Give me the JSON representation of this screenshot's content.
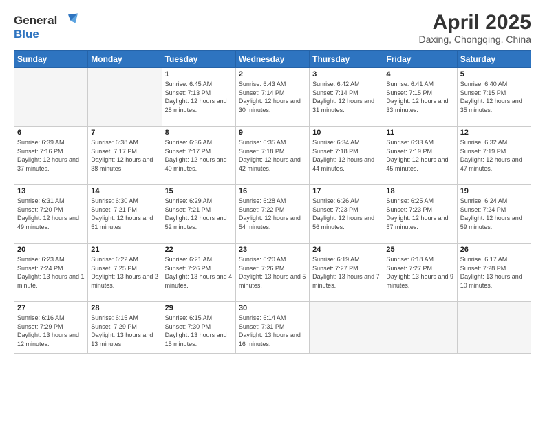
{
  "header": {
    "logo_line1": "General",
    "logo_line2": "Blue",
    "month_title": "April 2025",
    "subtitle": "Daxing, Chongqing, China"
  },
  "weekdays": [
    "Sunday",
    "Monday",
    "Tuesday",
    "Wednesday",
    "Thursday",
    "Friday",
    "Saturday"
  ],
  "weeks": [
    [
      {
        "day": "",
        "info": ""
      },
      {
        "day": "",
        "info": ""
      },
      {
        "day": "1",
        "info": "Sunrise: 6:45 AM\nSunset: 7:13 PM\nDaylight: 12 hours and 28 minutes."
      },
      {
        "day": "2",
        "info": "Sunrise: 6:43 AM\nSunset: 7:14 PM\nDaylight: 12 hours and 30 minutes."
      },
      {
        "day": "3",
        "info": "Sunrise: 6:42 AM\nSunset: 7:14 PM\nDaylight: 12 hours and 31 minutes."
      },
      {
        "day": "4",
        "info": "Sunrise: 6:41 AM\nSunset: 7:15 PM\nDaylight: 12 hours and 33 minutes."
      },
      {
        "day": "5",
        "info": "Sunrise: 6:40 AM\nSunset: 7:15 PM\nDaylight: 12 hours and 35 minutes."
      }
    ],
    [
      {
        "day": "6",
        "info": "Sunrise: 6:39 AM\nSunset: 7:16 PM\nDaylight: 12 hours and 37 minutes."
      },
      {
        "day": "7",
        "info": "Sunrise: 6:38 AM\nSunset: 7:17 PM\nDaylight: 12 hours and 38 minutes."
      },
      {
        "day": "8",
        "info": "Sunrise: 6:36 AM\nSunset: 7:17 PM\nDaylight: 12 hours and 40 minutes."
      },
      {
        "day": "9",
        "info": "Sunrise: 6:35 AM\nSunset: 7:18 PM\nDaylight: 12 hours and 42 minutes."
      },
      {
        "day": "10",
        "info": "Sunrise: 6:34 AM\nSunset: 7:18 PM\nDaylight: 12 hours and 44 minutes."
      },
      {
        "day": "11",
        "info": "Sunrise: 6:33 AM\nSunset: 7:19 PM\nDaylight: 12 hours and 45 minutes."
      },
      {
        "day": "12",
        "info": "Sunrise: 6:32 AM\nSunset: 7:19 PM\nDaylight: 12 hours and 47 minutes."
      }
    ],
    [
      {
        "day": "13",
        "info": "Sunrise: 6:31 AM\nSunset: 7:20 PM\nDaylight: 12 hours and 49 minutes."
      },
      {
        "day": "14",
        "info": "Sunrise: 6:30 AM\nSunset: 7:21 PM\nDaylight: 12 hours and 51 minutes."
      },
      {
        "day": "15",
        "info": "Sunrise: 6:29 AM\nSunset: 7:21 PM\nDaylight: 12 hours and 52 minutes."
      },
      {
        "day": "16",
        "info": "Sunrise: 6:28 AM\nSunset: 7:22 PM\nDaylight: 12 hours and 54 minutes."
      },
      {
        "day": "17",
        "info": "Sunrise: 6:26 AM\nSunset: 7:23 PM\nDaylight: 12 hours and 56 minutes."
      },
      {
        "day": "18",
        "info": "Sunrise: 6:25 AM\nSunset: 7:23 PM\nDaylight: 12 hours and 57 minutes."
      },
      {
        "day": "19",
        "info": "Sunrise: 6:24 AM\nSunset: 7:24 PM\nDaylight: 12 hours and 59 minutes."
      }
    ],
    [
      {
        "day": "20",
        "info": "Sunrise: 6:23 AM\nSunset: 7:24 PM\nDaylight: 13 hours and 1 minute."
      },
      {
        "day": "21",
        "info": "Sunrise: 6:22 AM\nSunset: 7:25 PM\nDaylight: 13 hours and 2 minutes."
      },
      {
        "day": "22",
        "info": "Sunrise: 6:21 AM\nSunset: 7:26 PM\nDaylight: 13 hours and 4 minutes."
      },
      {
        "day": "23",
        "info": "Sunrise: 6:20 AM\nSunset: 7:26 PM\nDaylight: 13 hours and 5 minutes."
      },
      {
        "day": "24",
        "info": "Sunrise: 6:19 AM\nSunset: 7:27 PM\nDaylight: 13 hours and 7 minutes."
      },
      {
        "day": "25",
        "info": "Sunrise: 6:18 AM\nSunset: 7:27 PM\nDaylight: 13 hours and 9 minutes."
      },
      {
        "day": "26",
        "info": "Sunrise: 6:17 AM\nSunset: 7:28 PM\nDaylight: 13 hours and 10 minutes."
      }
    ],
    [
      {
        "day": "27",
        "info": "Sunrise: 6:16 AM\nSunset: 7:29 PM\nDaylight: 13 hours and 12 minutes."
      },
      {
        "day": "28",
        "info": "Sunrise: 6:15 AM\nSunset: 7:29 PM\nDaylight: 13 hours and 13 minutes."
      },
      {
        "day": "29",
        "info": "Sunrise: 6:15 AM\nSunset: 7:30 PM\nDaylight: 13 hours and 15 minutes."
      },
      {
        "day": "30",
        "info": "Sunrise: 6:14 AM\nSunset: 7:31 PM\nDaylight: 13 hours and 16 minutes."
      },
      {
        "day": "",
        "info": ""
      },
      {
        "day": "",
        "info": ""
      },
      {
        "day": "",
        "info": ""
      }
    ]
  ]
}
